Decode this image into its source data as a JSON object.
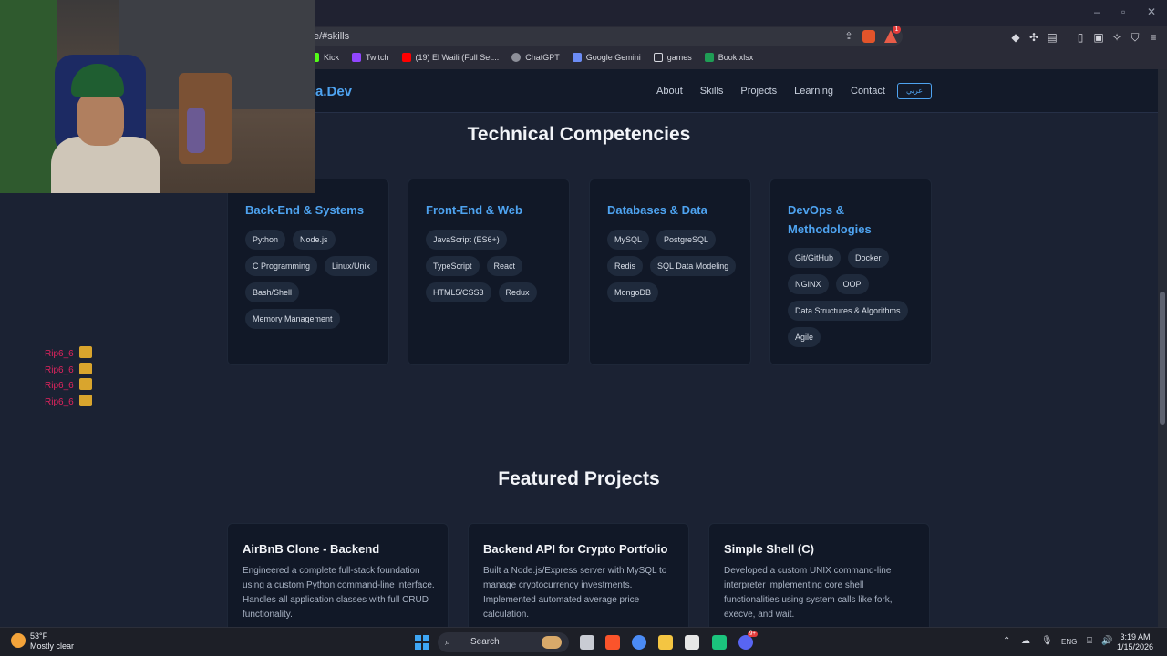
{
  "browser": {
    "url": "e/#skills",
    "bookmarks": [
      "Kick",
      "Twitch",
      "(19) El Waili (Full Set...",
      "ChatGPT",
      "Google Gemini",
      "games",
      "Book.xlsx"
    ],
    "notification_count": "1"
  },
  "nav": {
    "logo": "a.Dev",
    "links": [
      "About",
      "Skills",
      "Projects",
      "Learning",
      "Contact"
    ],
    "lang_button": "عربي"
  },
  "skills": {
    "title": "Technical Competencies",
    "cards": [
      {
        "title": "Back-End & Systems",
        "tags": [
          "Python",
          "Node.js",
          "C Programming",
          "Linux/Unix",
          "Bash/Shell",
          "Memory Management"
        ]
      },
      {
        "title": "Front-End & Web",
        "tags": [
          "JavaScript (ES6+)",
          "TypeScript",
          "React",
          "HTML5/CSS3",
          "Redux"
        ]
      },
      {
        "title": "Databases & Data",
        "tags": [
          "MySQL",
          "PostgreSQL",
          "Redis",
          "SQL Data Modeling",
          "MongoDB"
        ]
      },
      {
        "title": "DevOps & Methodologies",
        "tags": [
          "Git/GitHub",
          "Docker",
          "NGINX",
          "OOP",
          "Data Structures & Algorithms",
          "Agile"
        ]
      }
    ]
  },
  "projects": {
    "title": "Featured Projects",
    "cards": [
      {
        "title": "AirBnB Clone - Backend",
        "desc": "Engineered a complete full-stack foundation using a custom Python command-line interface. Handles all application classes with full CRUD functionality."
      },
      {
        "title": "Backend API for Crypto Portfolio",
        "desc": "Built a Node.js/Express server with MySQL to manage cryptocurrency investments. Implemented automated average price calculation."
      },
      {
        "title": "Simple Shell (C)",
        "desc": "Developed a custom UNIX command-line interpreter implementing core shell functionalities using system calls like fork, execve, and wait."
      }
    ]
  },
  "chat": [
    "Rip6_6",
    "Rip6_6",
    "Rip6_6",
    "Rip6_6"
  ],
  "taskbar": {
    "temp": "53°F",
    "weather": "Mostly clear",
    "search": "Search",
    "lang": "ENG",
    "time": "3:19 AM",
    "date": "1/15/2026",
    "discord_badge": "9+"
  },
  "colors": {
    "accent": "#4ea3f0",
    "page_bg": "#1b2233",
    "card_bg": "#111827",
    "chat_red": "#e0245e"
  }
}
